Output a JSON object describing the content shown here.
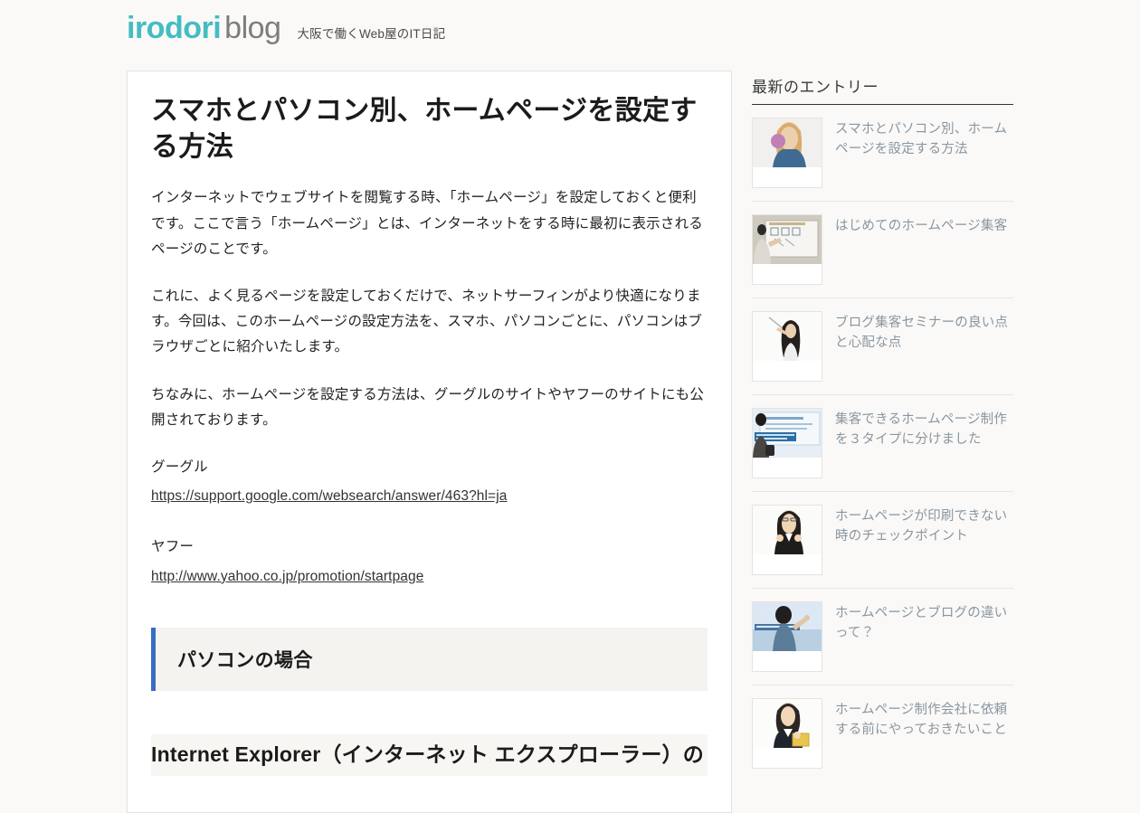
{
  "header": {
    "logo_primary": "irodori",
    "logo_secondary": "blog",
    "tagline": "大阪で働くWeb屋のIT日記"
  },
  "article": {
    "title": "スマホとパソコン別、ホームページを設定する方法",
    "paragraphs": [
      "インターネットでウェブサイトを閲覧する時、「ホームページ」を設定しておくと便利です。ここで言う「ホームページ」とは、インターネットをする時に最初に表示されるページのことです。",
      "これに、よく見るページを設定しておくだけで、ネットサーフィンがより快適になります。今回は、このホームページの設定方法を、スマホ、パソコンごとに、パソコンはブラウザごとに紹介いたします。",
      "ちなみに、ホームページを設定する方法は、グーグルのサイトやヤフーのサイトにも公開されております。"
    ],
    "links": [
      {
        "label": "グーグル",
        "url": "https://support.google.com/websearch/answer/463?hl=ja"
      },
      {
        "label": "ヤフー",
        "url": "http://www.yahoo.co.jp/promotion/startpage"
      }
    ],
    "section_heading": "パソコンの場合",
    "sub_heading": "Internet Explorer（インターネット エクスプローラー）の"
  },
  "sidebar": {
    "widget_title": "最新のエントリー",
    "entries": [
      {
        "title": "スマホとパソコン別、ホームページを設定する方法",
        "thumb": "woman-phone-photo"
      },
      {
        "title": "はじめてのホームページ集客",
        "thumb": "man-whiteboard-photo"
      },
      {
        "title": "ブログ集客セミナーの良い点と心配な点",
        "thumb": "woman-pointer-photo"
      },
      {
        "title": "集客できるホームページ制作を３タイプに分けました",
        "thumb": "seminar-screen-photo"
      },
      {
        "title": "ホームページが印刷できない時のチェックポイント",
        "thumb": "woman-suit-photo"
      },
      {
        "title": "ホームページとブログの違いって？",
        "thumb": "man-board-blue-photo"
      },
      {
        "title": "ホームページ制作会社に依頼する前にやっておきたいこと",
        "thumb": "woman-folder-photo"
      }
    ]
  },
  "colors": {
    "logo_accent": "#45bcc3",
    "heading_accent": "#3a6cc1",
    "page_background": "#faf9f7",
    "sidebar_link": "#8a95a0"
  }
}
